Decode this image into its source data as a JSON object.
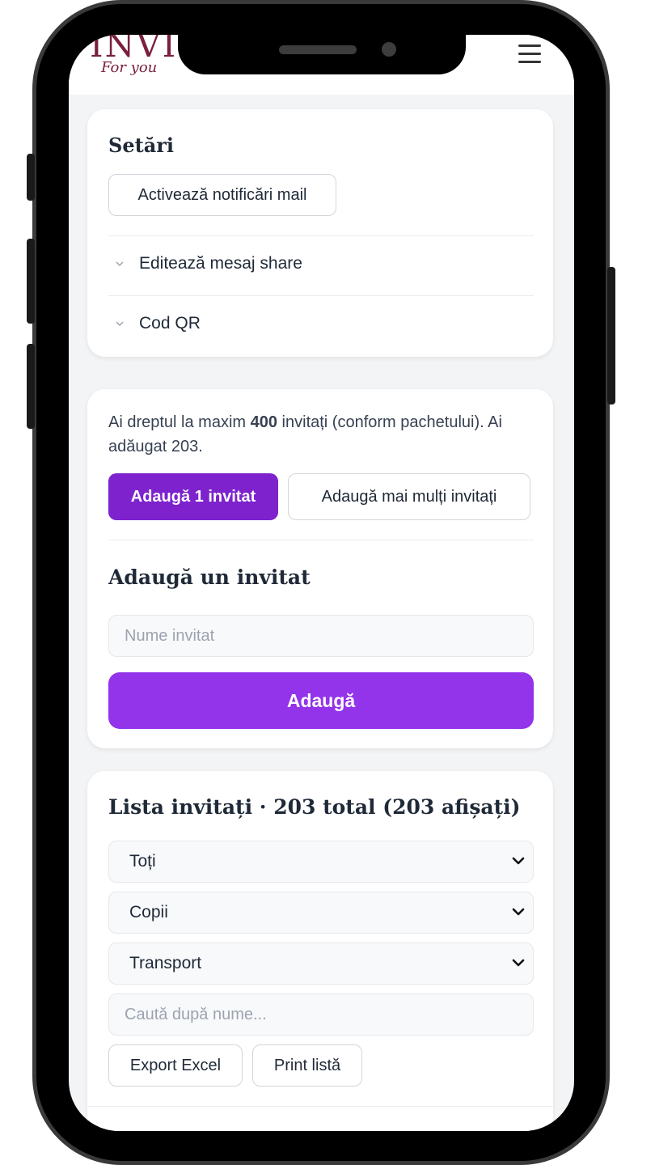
{
  "header": {
    "logo_text": "INVI",
    "logo_tagline": "For you",
    "menu_icon": "hamburger-menu-icon"
  },
  "settings": {
    "title": "Setări",
    "mail_button": "Activează notificări mail",
    "accordion": [
      {
        "label": "Editează mesaj share",
        "icon": "chevron-down-icon"
      },
      {
        "label": "Cod QR",
        "icon": "chevron-down-icon"
      }
    ]
  },
  "invite_limit": {
    "text_before": "Ai dreptul la maxim ",
    "max": "400",
    "text_after": " invitați (conform pachetului). Ai adăugat 203.",
    "add_one_button": "Adaugă 1 invitat",
    "add_many_button": "Adaugă mai mulți invitați",
    "form_title": "Adaugă un invitat",
    "name_placeholder": "Nume invitat",
    "submit_button": "Adaugă"
  },
  "guest_list": {
    "title": "Lista invitați · 203 total (203 afișați)",
    "filters": [
      {
        "value": "Toți"
      },
      {
        "value": "Copii"
      },
      {
        "value": "Transport"
      }
    ],
    "search_placeholder": "Caută după nume...",
    "export_button": "Export Excel",
    "print_button": "Print listă"
  },
  "colors": {
    "primary": "#7e22ce",
    "primary_light": "#9333ea",
    "logo": "#7a1f3e",
    "page_bg": "#f3f4f6"
  }
}
